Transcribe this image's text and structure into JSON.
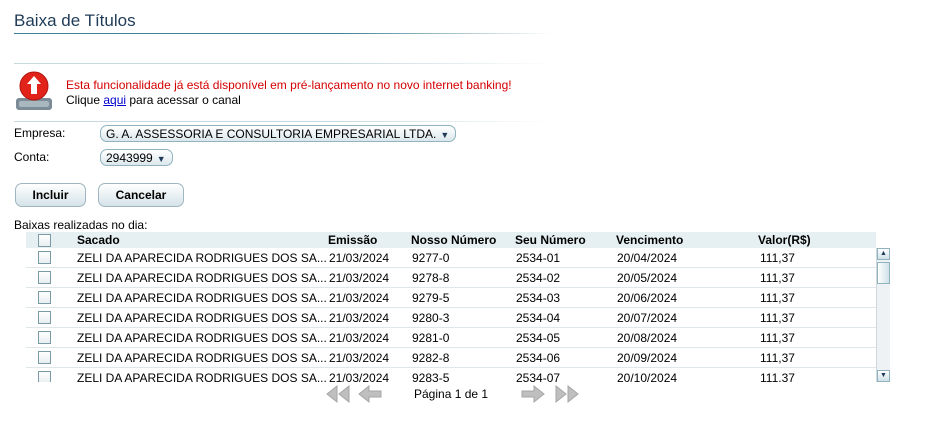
{
  "page": {
    "title": "Baixa de Títulos"
  },
  "notice": {
    "message": "Esta funcionalidade já está disponível em pré-lançamento no novo internet banking!",
    "prefix": "Clique ",
    "link": "aqui",
    "suffix": " para acessar o canal",
    "icon": "upload-alert-icon"
  },
  "form": {
    "empresa_label": "Empresa:",
    "empresa_value": "G. A. ASSESSORIA E CONSULTORIA EMPRESARIAL LTDA.",
    "conta_label": "Conta:",
    "conta_value": "2943999"
  },
  "buttons": {
    "incluir": "Incluir",
    "cancelar": "Cancelar"
  },
  "grid": {
    "section_label": "Baixas realizadas no dia:",
    "headers": {
      "sacado": "Sacado",
      "emissao": "Emissão",
      "nosso_numero": "Nosso Número",
      "seu_numero": "Seu Número",
      "vencimento": "Vencimento",
      "valor": "Valor(R$)"
    },
    "rows": [
      {
        "sacado": "ZELI DA APARECIDA RODRIGUES DOS SA...",
        "emissao": "21/03/2024",
        "nosso": "9277-0",
        "seu": "2534-01",
        "venc": "20/04/2024",
        "valor": "111,37"
      },
      {
        "sacado": "ZELI DA APARECIDA RODRIGUES DOS SA...",
        "emissao": "21/03/2024",
        "nosso": "9278-8",
        "seu": "2534-02",
        "venc": "20/05/2024",
        "valor": "111,37"
      },
      {
        "sacado": "ZELI DA APARECIDA RODRIGUES DOS SA...",
        "emissao": "21/03/2024",
        "nosso": "9279-5",
        "seu": "2534-03",
        "venc": "20/06/2024",
        "valor": "111,37"
      },
      {
        "sacado": "ZELI DA APARECIDA RODRIGUES DOS SA...",
        "emissao": "21/03/2024",
        "nosso": "9280-3",
        "seu": "2534-04",
        "venc": "20/07/2024",
        "valor": "111,37"
      },
      {
        "sacado": "ZELI DA APARECIDA RODRIGUES DOS SA...",
        "emissao": "21/03/2024",
        "nosso": "9281-0",
        "seu": "2534-05",
        "venc": "20/08/2024",
        "valor": "111,37"
      },
      {
        "sacado": "ZELI DA APARECIDA RODRIGUES DOS SA...",
        "emissao": "21/03/2024",
        "nosso": "9282-8",
        "seu": "2534-06",
        "venc": "20/09/2024",
        "valor": "111,37"
      },
      {
        "sacado": "ZELI DA APARECIDA RODRIGUES DOS SA...",
        "emissao": "21/03/2024",
        "nosso": "9283-5",
        "seu": "2534-07",
        "venc": "20/10/2024",
        "valor": "111,37"
      }
    ]
  },
  "pager": {
    "text": "Página 1 de 1"
  },
  "colors": {
    "title": "#1f3b57",
    "notice_red": "#d40000",
    "header_bg": "#e6f0f3",
    "link": "#0000cc"
  }
}
